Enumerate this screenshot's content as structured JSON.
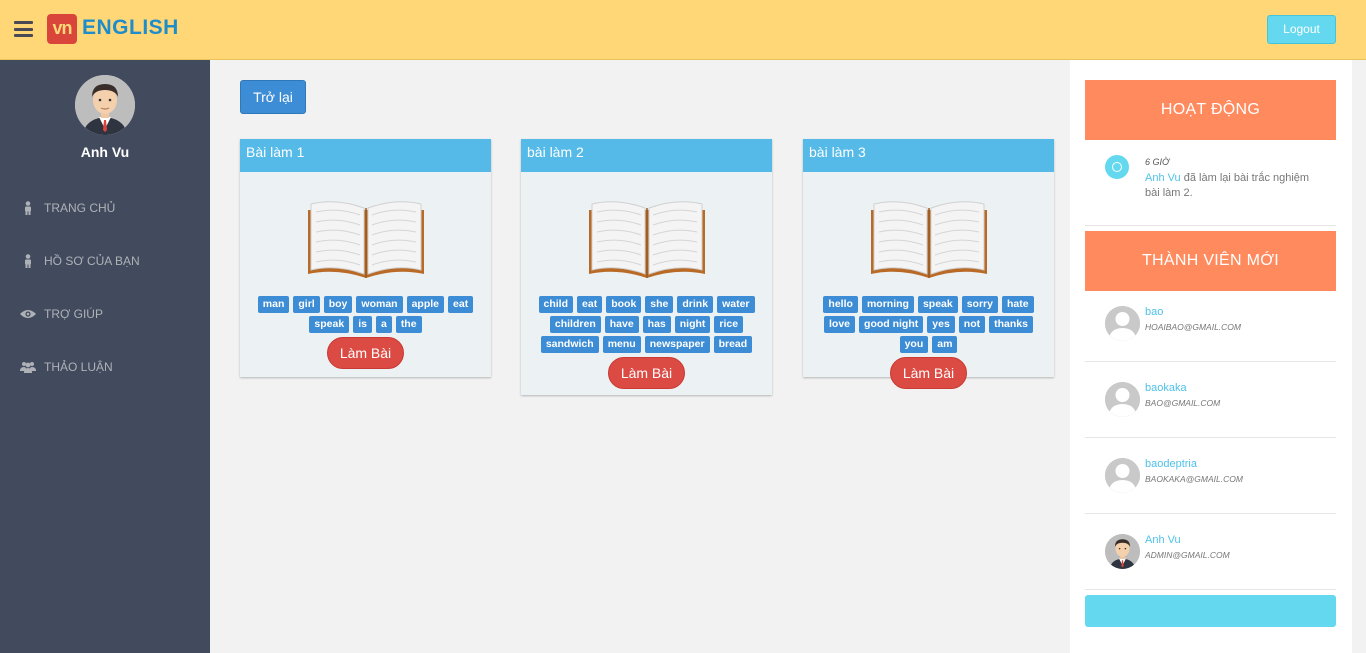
{
  "header": {
    "logo_mark": "vn",
    "logo_text": "ENGLISH",
    "logout_label": "Logout"
  },
  "sidebar": {
    "user_name": "Anh Vu",
    "items": [
      {
        "label": "TRANG CHỦ",
        "icon": "person-icon"
      },
      {
        "label": "HỒ SƠ CỦA BẠN",
        "icon": "person-icon"
      },
      {
        "label": "TRỢ GIÚP",
        "icon": "eye-icon"
      },
      {
        "label": "THẢO LUẬN",
        "icon": "users-icon"
      }
    ]
  },
  "main": {
    "back_label": "Trở lại",
    "cards": [
      {
        "title": "Bài làm 1",
        "words": [
          "man",
          "girl",
          "boy",
          "woman",
          "apple",
          "eat",
          "speak",
          "is",
          "a",
          "the"
        ],
        "button": "Làm Bài"
      },
      {
        "title": "bài làm 2",
        "words": [
          "child",
          "eat",
          "book",
          "she",
          "drink",
          "water",
          "children",
          "have",
          "has",
          "night",
          "rice",
          "sandwich",
          "menu",
          "newspaper",
          "bread"
        ],
        "button": "Làm Bài"
      },
      {
        "title": "bài làm 3",
        "words": [
          "hello",
          "morning",
          "speak",
          "sorry",
          "hate",
          "love",
          "good night",
          "yes",
          "not",
          "thanks",
          "you",
          "am"
        ],
        "button": "Làm Bài"
      }
    ]
  },
  "right": {
    "activity_title": "HOẠT ĐỘNG",
    "activity": {
      "time": "6 GIỜ",
      "who": "Anh Vu",
      "text": " đã làm lại bài trắc nghiệm bài làm 2."
    },
    "members_title": "THÀNH VIÊN MỚI",
    "members": [
      {
        "name": "bao",
        "email": "HOAIBAO@GMAIL.COM",
        "avatar": "default"
      },
      {
        "name": "baokaka",
        "email": "BAO@GMAIL.COM",
        "avatar": "default"
      },
      {
        "name": "baodeptria",
        "email": "BAOKAKA@GMAIL.COM",
        "avatar": "default"
      },
      {
        "name": "Anh Vu",
        "email": "ADMIN@GMAIL.COM",
        "avatar": "photo"
      }
    ]
  },
  "colors": {
    "header": "#ffd777",
    "sidebar": "#424a5d",
    "card_head": "#55bae8",
    "tag": "#3c8dd5",
    "do_button": "#dc4b43",
    "panel_head": "#ff8a5e",
    "accent": "#63d8ee"
  }
}
